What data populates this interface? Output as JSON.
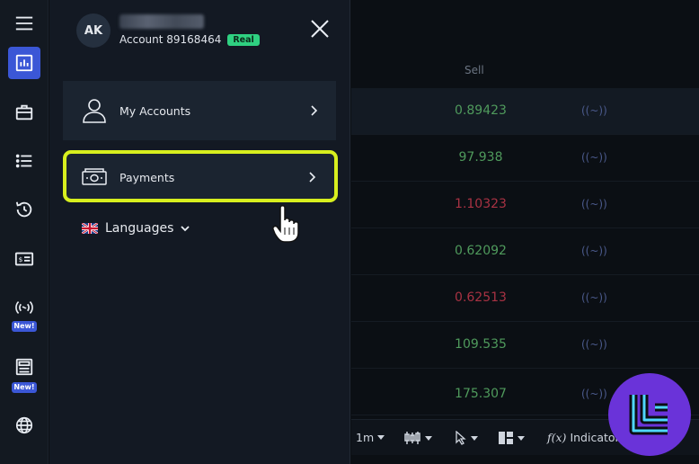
{
  "drawer": {
    "avatar_initials": "AK",
    "account_label": "Account 89168464",
    "account_type_badge": "Real",
    "menu": {
      "my_accounts": "My Accounts",
      "payments": "Payments",
      "languages": "Languages"
    }
  },
  "rail": {
    "badges": {
      "signals": "New!",
      "news": "New!"
    }
  },
  "table": {
    "sell_header": "Sell",
    "rows": [
      {
        "price": "0.89423",
        "direction": "up"
      },
      {
        "price": "97.938",
        "direction": "up"
      },
      {
        "price": "1.10323",
        "direction": "down"
      },
      {
        "price": "0.62092",
        "direction": "up"
      },
      {
        "price": "0.62513",
        "direction": "down"
      },
      {
        "price": "109.535",
        "direction": "up"
      },
      {
        "price": "175.307",
        "direction": "up"
      }
    ],
    "signal_glyph": "((~))"
  },
  "toolbar": {
    "timeframe": "1m",
    "indicators_label": "Indicator"
  },
  "colors": {
    "accent": "#3b57d6",
    "highlight": "#d8ef1e",
    "real_badge": "#2fd181",
    "price_up": "#4f9a5c",
    "price_down": "#a83243",
    "logo_bg": "#6a33d9"
  }
}
